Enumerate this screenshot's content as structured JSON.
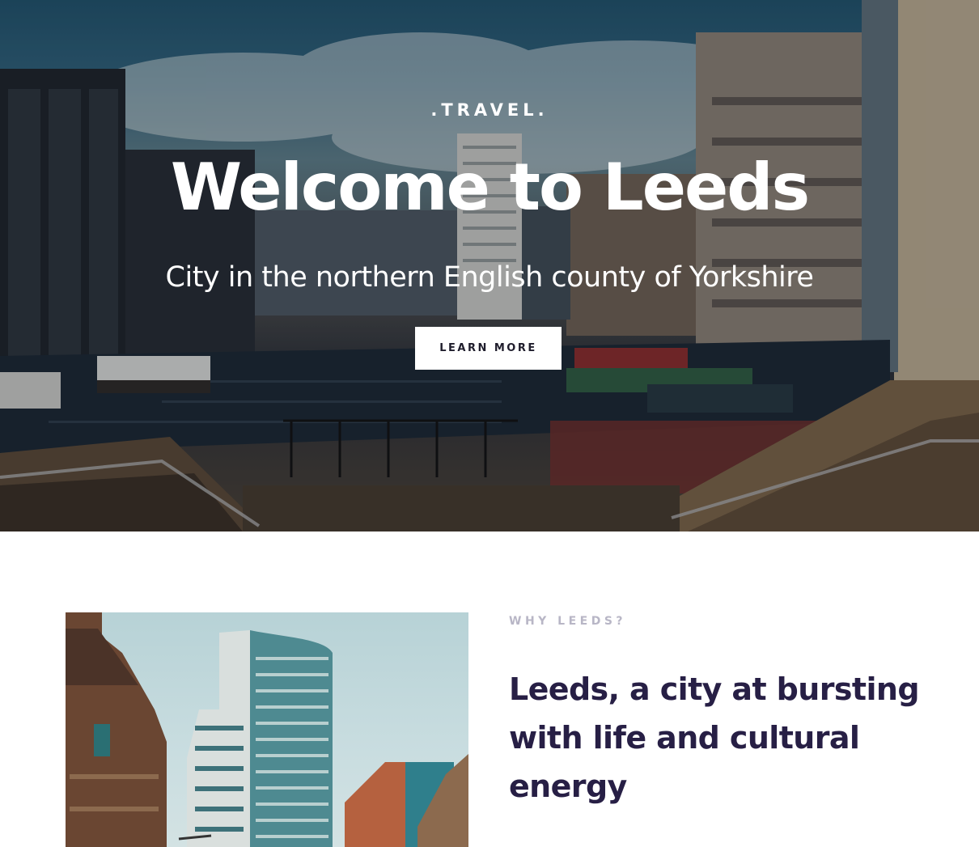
{
  "hero": {
    "eyebrow": ".TRAVEL.",
    "title": "Welcome to Leeds",
    "subtitle": "City in the northern English county of Yorkshire",
    "cta_label": "LEARN MORE"
  },
  "about": {
    "eyebrow": "WHY LEEDS?",
    "heading": "Leeds, a city at bursting with life and cultural energy"
  },
  "colors": {
    "heading_dark": "#271f45",
    "eyebrow_muted": "#b8b6c6",
    "button_bg": "#ffffff",
    "button_text": "#1f1d2c"
  }
}
